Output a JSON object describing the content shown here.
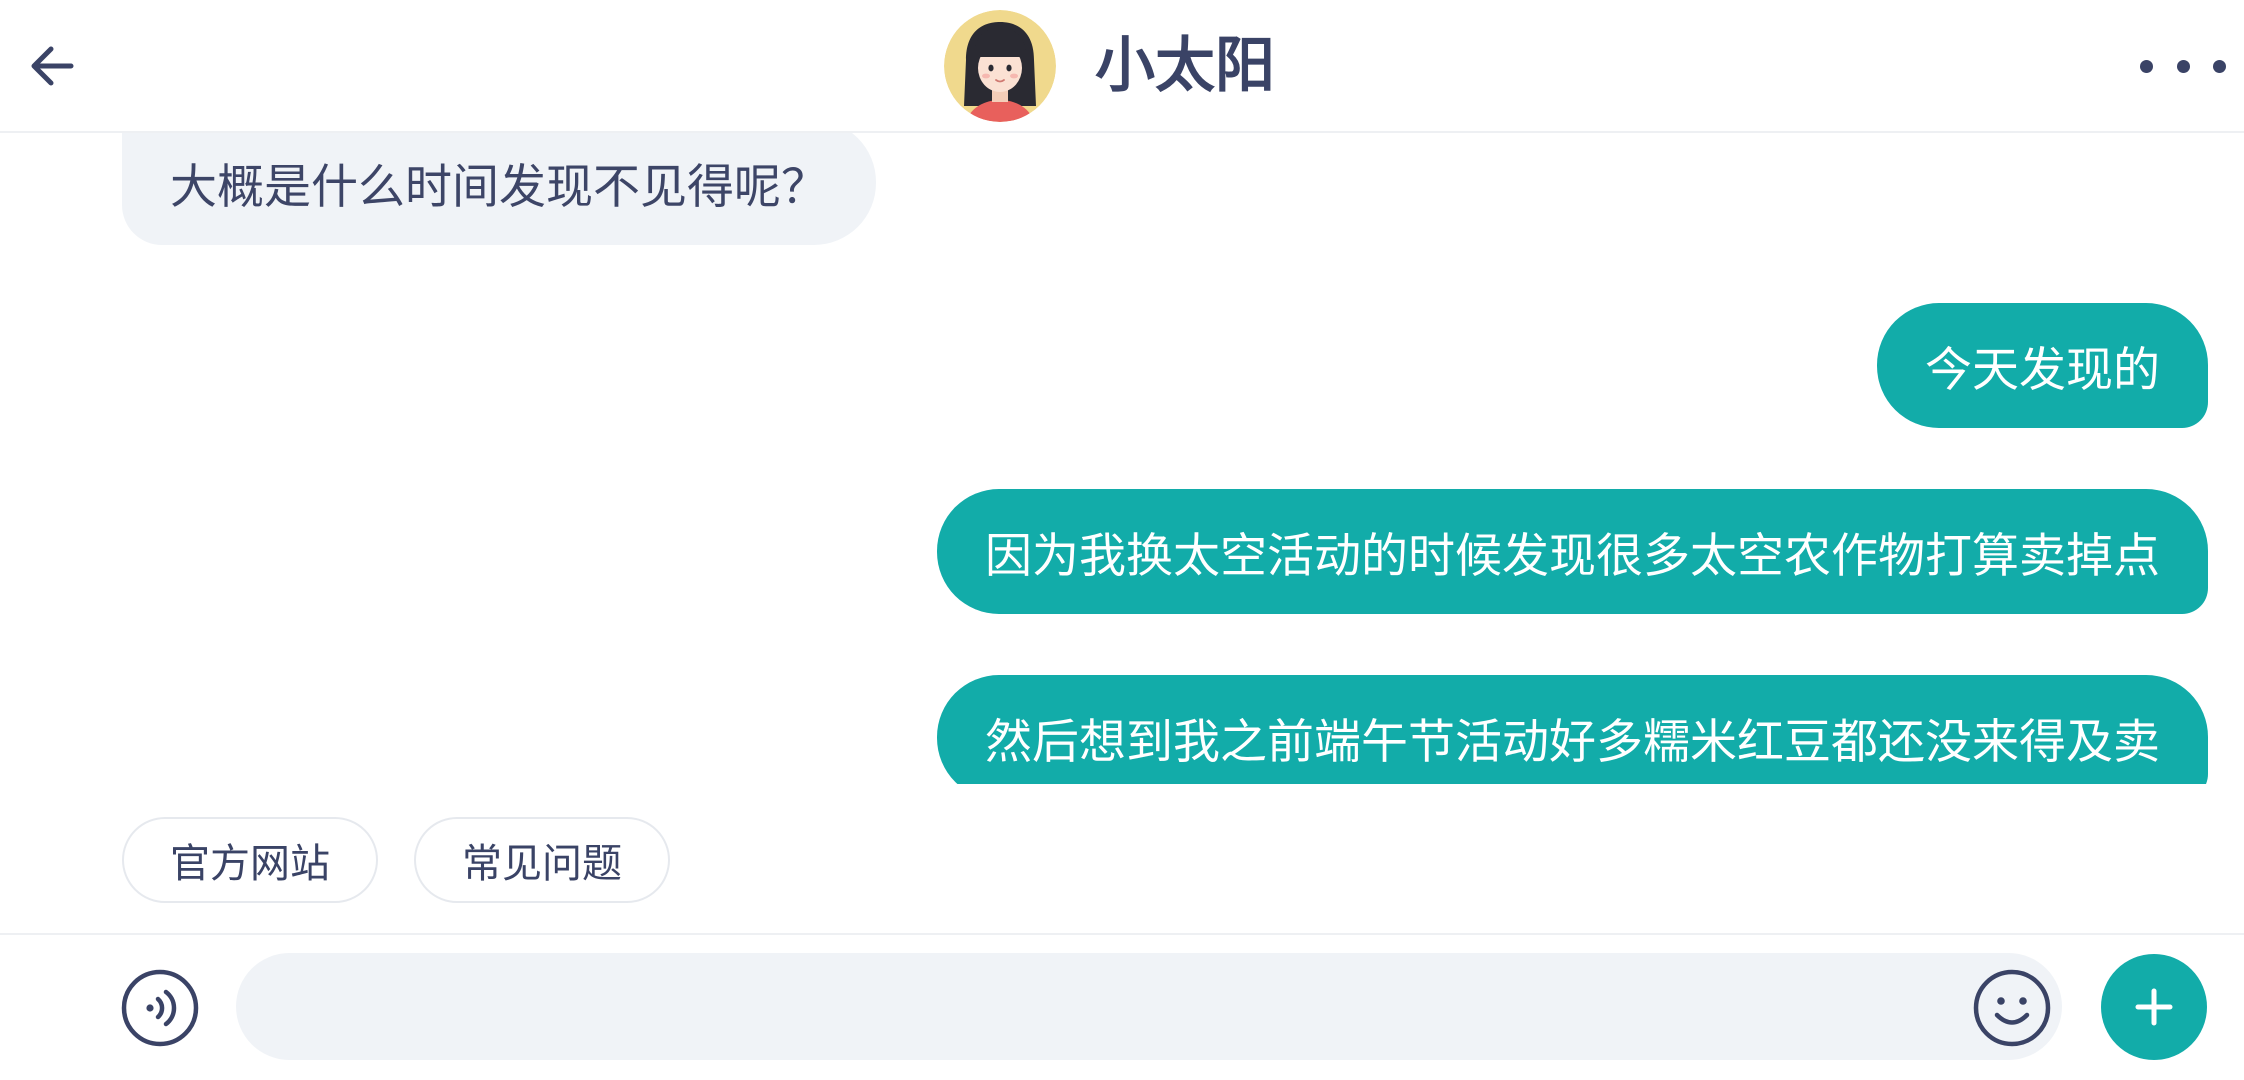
{
  "header": {
    "title": "小太阳",
    "back_icon": "arrow-left-icon",
    "more_icon": "more-horizontal-icon"
  },
  "messages": [
    {
      "from": "agent",
      "text": "大概是什么时间发现不见得呢？"
    },
    {
      "from": "user",
      "text": "今天发现的"
    },
    {
      "from": "user",
      "text": "因为我换太空活动的时候发现很多太空农作物打算卖掉点"
    },
    {
      "from": "user",
      "text": "然后想到我之前端午节活动好多糯米红豆都还没来得及卖"
    }
  ],
  "quick_replies": [
    {
      "label": "官方网站"
    },
    {
      "label": "常见问题"
    }
  ],
  "composer": {
    "value": "",
    "placeholder": "",
    "voice_icon": "voice-icon",
    "emoji_icon": "emoji-icon",
    "plus_icon": "plus-icon"
  },
  "colors": {
    "accent": "#12aca9",
    "agent_bubble": "#f0f3f7",
    "text": "#3a4366",
    "divider": "#eef0f3"
  }
}
